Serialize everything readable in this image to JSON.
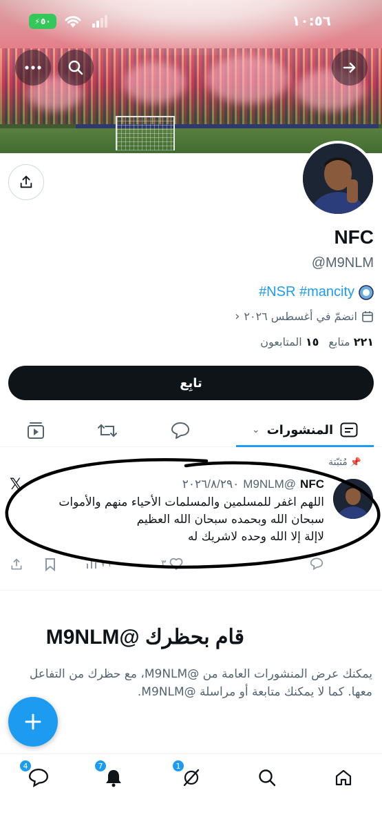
{
  "status_bar": {
    "time": "١٠:٥٦",
    "battery": "٥٠"
  },
  "profile": {
    "name": "NFC",
    "handle": "@M9NLM",
    "bio": "#NSR #mancity",
    "joined": "انضمّ في أغسطس ٢٠٢٦",
    "following_count": "٢٢١",
    "following_label": "متابع",
    "followers_count": "١٥",
    "followers_label": "المتابعون",
    "follow_label": "تابِع"
  },
  "tabs": {
    "posts_label": "المنشورات"
  },
  "pinned_post": {
    "pinned_label": "مُثبّتة",
    "author_name": "NFC",
    "author_handle": "@M9NLM",
    "date": "٢٠٢٦/٨/٢٩٠",
    "text_line1": "اللهم اغفر للمسلمين والمسلمات الأحياء منهم والأموات",
    "text_line2": "سبحان الله وبحمده سبحان الله العظيم",
    "text_line3": "لاإلة إلا الله وحده لاشريك له",
    "views": "٧٦٠",
    "likes": "٣"
  },
  "blocked": {
    "title": "قام بحظرك @M9NLM",
    "message": "يمكنك عرض المنشورات العامة من @M9NLM، مع حظرك من التفاعل معها. كما لا يمكنك متابعة أو مراسلة @M9NLM."
  },
  "bottom_nav": {
    "messages_badge": "4",
    "notifications_badge": "7",
    "grok_badge": "1"
  },
  "colors": {
    "accent": "#1d9bf0",
    "text": "#0f1419",
    "muted": "#536471"
  }
}
